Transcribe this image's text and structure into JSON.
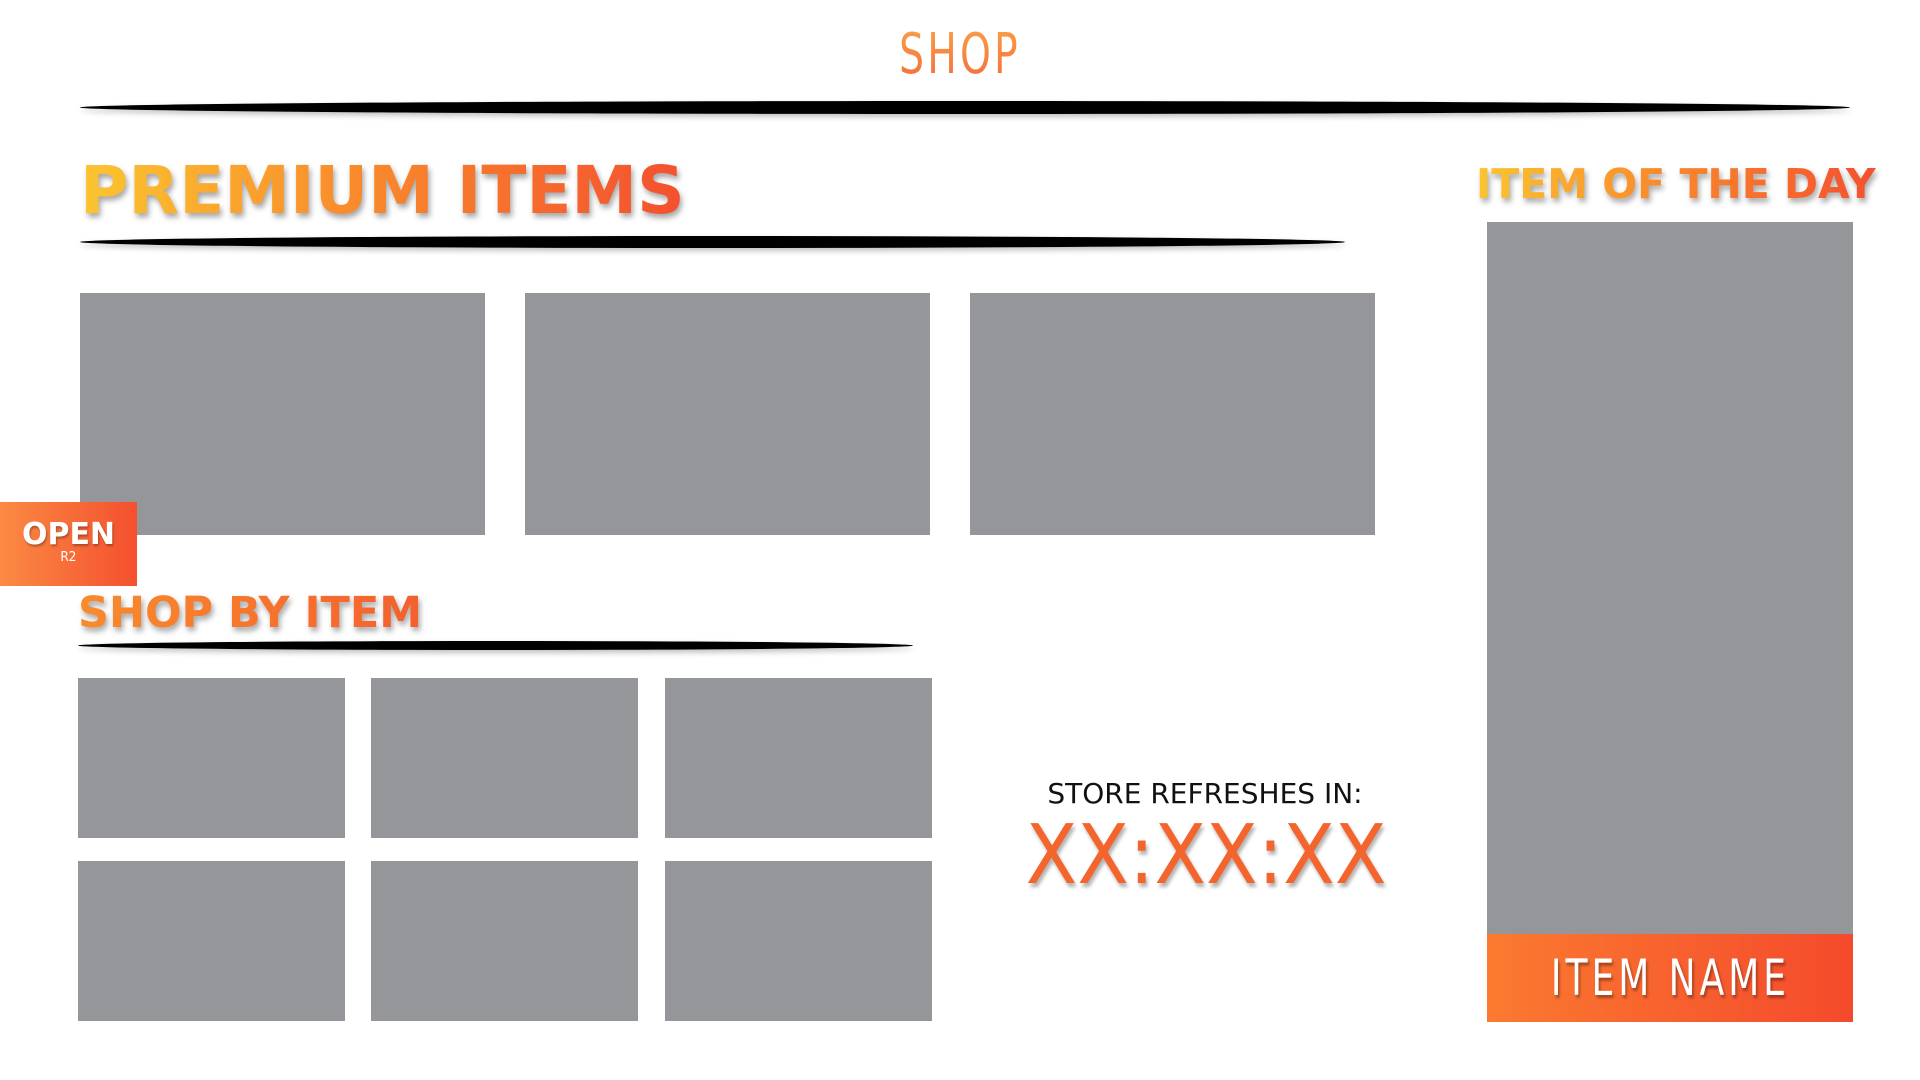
{
  "header": {
    "title": "SHOP"
  },
  "premium": {
    "heading": "PREMIUM ITEMS",
    "slots": 3
  },
  "shop_by_item": {
    "heading": "SHOP BY ITEM",
    "slots": 6
  },
  "open_button": {
    "label": "OPEN",
    "key_hint": "R2"
  },
  "store_refresh": {
    "label": "STORE REFRESHES IN:",
    "timer": "XX:XX:XX"
  },
  "item_of_the_day": {
    "heading": "ITEM OF THE DAY",
    "item_name": "ITEM NAME"
  },
  "colors": {
    "accent_orange": "#f4652d",
    "accent_yellow": "#fbc52f",
    "slot_gray": "#959699",
    "divider": "#000000"
  }
}
